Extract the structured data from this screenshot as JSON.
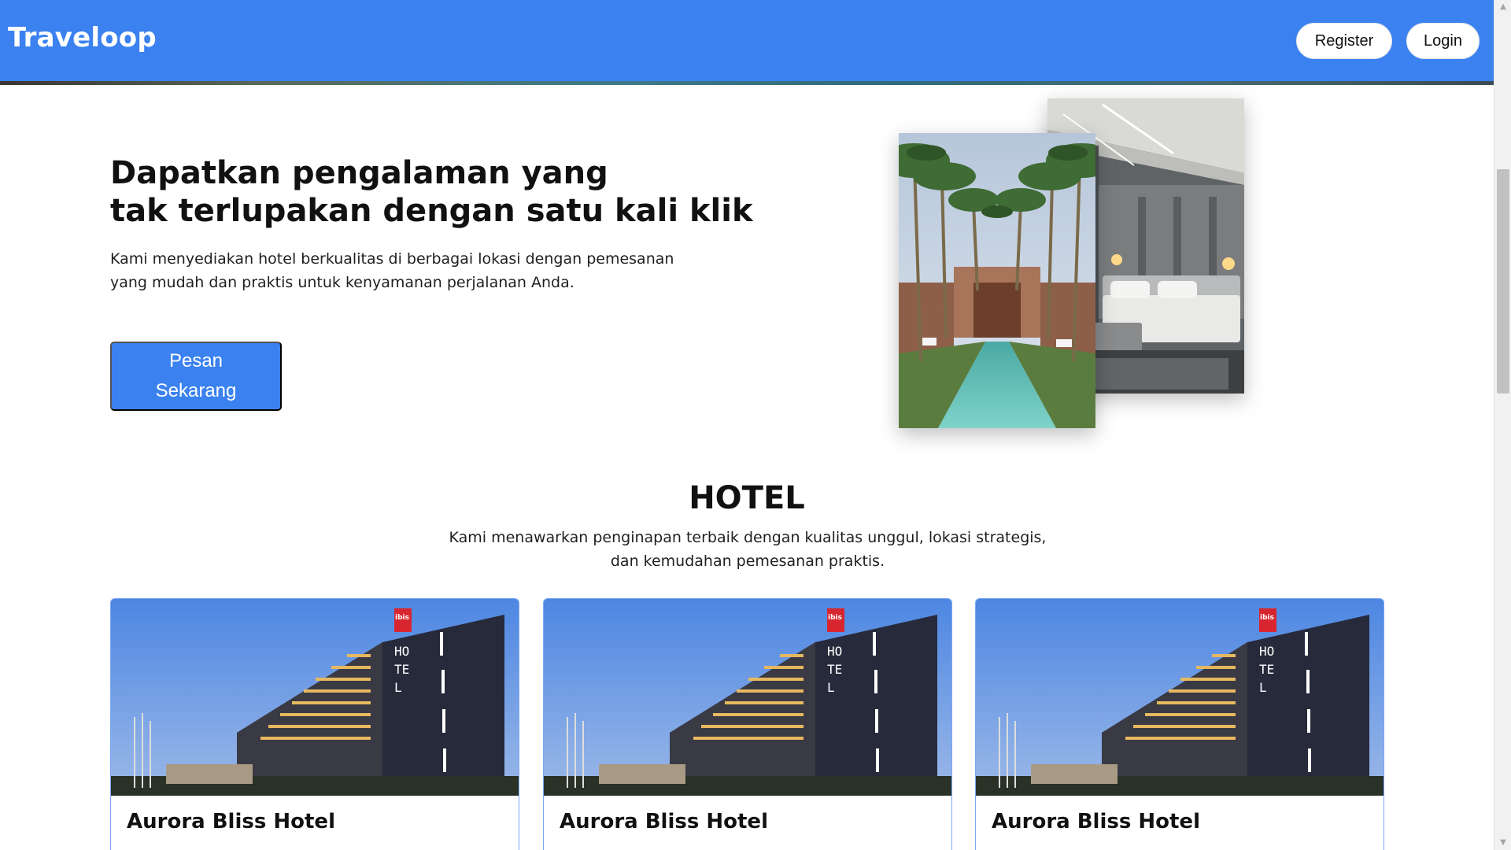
{
  "navbar": {
    "brand": "Traveloop",
    "register_label": "Register",
    "login_label": "Login"
  },
  "hero": {
    "title_line1": "Dapatkan pengalaman yang",
    "title_line2": "tak terlupakan dengan satu kali klik",
    "desc_line1": "Kami menyediakan hotel berkualitas di berbagai lokasi dengan pemesanan",
    "desc_line2": "yang mudah dan praktis untuk kenyamanan perjalanan Anda.",
    "cta_label": "Pesan Sekarang"
  },
  "hotel_section": {
    "title": "HOTEL",
    "desc_line1": "Kami menawarkan penginapan terbaik dengan kualitas unggul, lokasi strategis,",
    "desc_line2": "dan kemudahan pemesanan praktis."
  },
  "cards": [
    {
      "name": "Aurora Bliss Hotel",
      "sign": "ibis",
      "vertical": "HOTEL"
    },
    {
      "name": "Aurora Bliss Hotel",
      "sign": "ibis",
      "vertical": "HOTEL"
    },
    {
      "name": "Aurora Bliss Hotel",
      "sign": "ibis",
      "vertical": "HOTEL"
    }
  ],
  "colors": {
    "primary": "#3b82f0",
    "card_border": "#7aa7f5"
  }
}
